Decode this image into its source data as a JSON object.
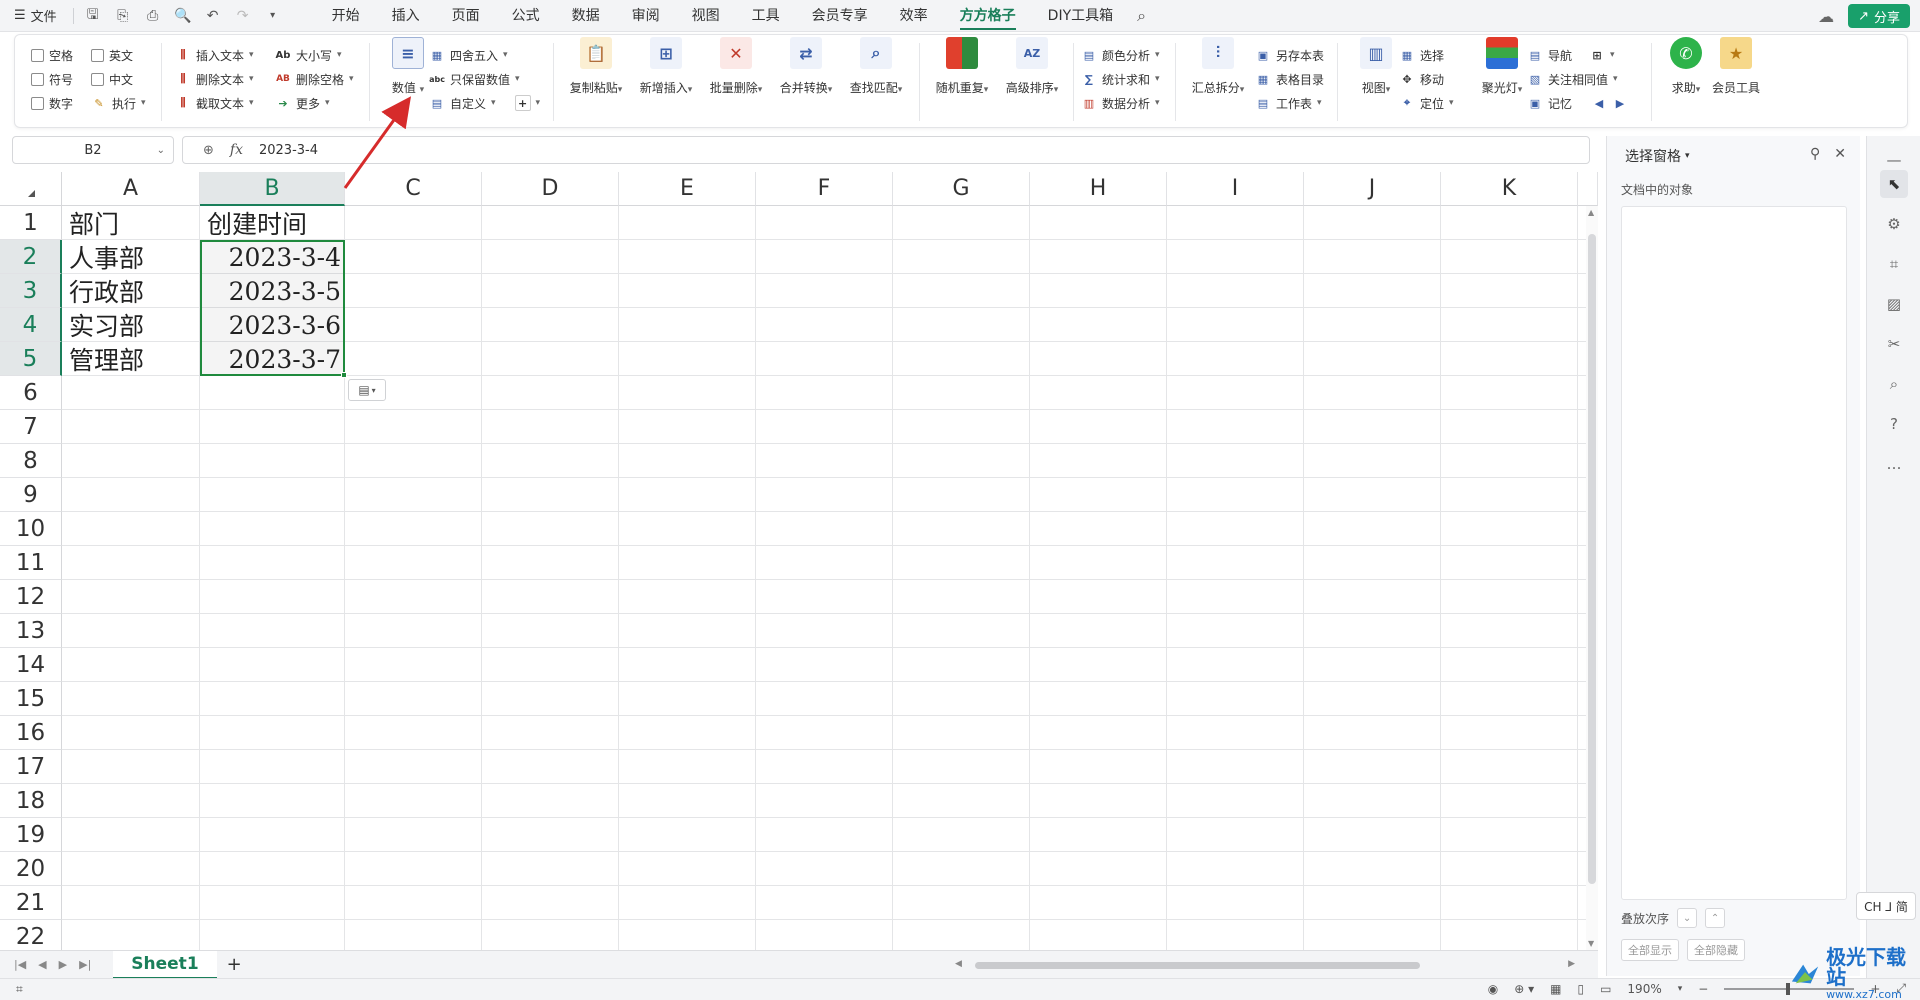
{
  "menubar": {
    "file_label": "文件",
    "tabs": [
      "开始",
      "插入",
      "页面",
      "公式",
      "数据",
      "审阅",
      "视图",
      "工具",
      "会员专享",
      "效率",
      "方方格子",
      "DIY工具箱"
    ],
    "active_tab": "方方格子",
    "share_label": "分享"
  },
  "ribbon": {
    "checkboxes": [
      "空格",
      "英文",
      "符号",
      "中文",
      "数字"
    ],
    "exec_label": "执行",
    "text_tools": [
      "插入文本",
      "删除文本",
      "截取文本"
    ],
    "case_tools": [
      "大小写",
      "删除空格",
      "更多"
    ],
    "value_label": "数值",
    "num_tools": [
      "四舍五入",
      "只保留数值",
      "自定义"
    ],
    "big_group1": [
      "复制粘贴",
      "新增插入",
      "批量删除",
      "合并转换",
      "查找匹配"
    ],
    "big_group2": [
      "随机重复",
      "高级排序"
    ],
    "analysis": [
      "颜色分析",
      "统计求和",
      "数据分析"
    ],
    "summary_label": "汇总拆分",
    "sheet_tools": [
      "另存本表",
      "表格目录",
      "工作表"
    ],
    "view_label": "视图",
    "select_tools": [
      "选择",
      "移动",
      "定位"
    ],
    "spotlight_label": "聚光灯",
    "nav_tools": [
      "导航",
      "关注相同值",
      "记忆"
    ],
    "help_label": "求助",
    "member_label": "会员工具"
  },
  "formula_bar": {
    "name_box": "B2",
    "fx_label": "fx",
    "value": "2023-3-4"
  },
  "grid": {
    "columns": [
      "A",
      "B",
      "C",
      "D",
      "E",
      "F",
      "G",
      "H",
      "I",
      "J",
      "K"
    ],
    "rows": [
      "1",
      "2",
      "3",
      "4",
      "5",
      "6",
      "7",
      "8",
      "9",
      "10",
      "11",
      "12",
      "13",
      "14",
      "15",
      "16",
      "17",
      "18",
      "19",
      "20",
      "21",
      "22"
    ],
    "selected_column": "B",
    "selected_rows": [
      "2",
      "3",
      "4",
      "5"
    ],
    "cells": {
      "A1": "部门",
      "B1": "创建时间",
      "A2": "人事部",
      "B2": "2023-3-4",
      "A3": "行政部",
      "B3": "2023-3-5",
      "A4": "实习部",
      "B4": "2023-3-6",
      "A5": "管理部",
      "B5": "2023-3-7"
    }
  },
  "sheet_bar": {
    "active_sheet": "Sheet1",
    "add_label": "+"
  },
  "status_bar": {
    "zoom": "190%"
  },
  "side_panel": {
    "title": "选择窗格",
    "subtitle": "文档中的对象",
    "order_label": "叠放次序",
    "show_all": "全部显示",
    "hide_all": "全部隐藏"
  },
  "ime": {
    "label": "CH ⅃ 简"
  },
  "watermark": {
    "cn": "极光下载站",
    "en": "www.xz7.com"
  },
  "colors": {
    "accent": "#1a7f5a",
    "selection_border": "#1f8a3d",
    "annotation": "#d62b2b",
    "share": "#19a06b"
  }
}
